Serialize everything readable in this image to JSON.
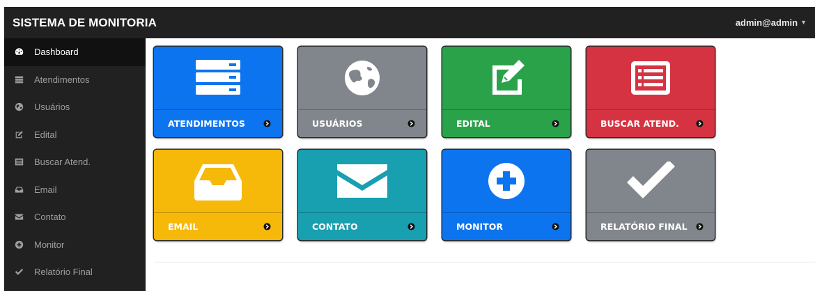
{
  "header": {
    "title": "SISTEMA DE MONITORIA",
    "user": "admin@admin"
  },
  "sidebar": {
    "items": [
      {
        "label": "Dashboard",
        "icon": "dashboard-icon",
        "active": true
      },
      {
        "label": "Atendimentos",
        "icon": "server-icon"
      },
      {
        "label": "Usuários",
        "icon": "globe-icon"
      },
      {
        "label": "Edital",
        "icon": "edit-icon"
      },
      {
        "label": "Buscar Atend.",
        "icon": "list-icon"
      },
      {
        "label": "Email",
        "icon": "inbox-icon"
      },
      {
        "label": "Contato",
        "icon": "envelope-icon"
      },
      {
        "label": "Monitor",
        "icon": "plus-circle-icon"
      },
      {
        "label": "Relatório Final",
        "icon": "check-icon"
      }
    ]
  },
  "tiles": [
    {
      "label": "ATENDIMENTOS",
      "icon": "server-icon",
      "color": "#0d74f0"
    },
    {
      "label": "USUÁRIOS",
      "icon": "globe-icon",
      "color": "#80868b"
    },
    {
      "label": "EDITAL",
      "icon": "edit-icon",
      "color": "#2aa24a"
    },
    {
      "label": "BUSCAR ATEND.",
      "icon": "list-icon",
      "color": "#d53342"
    },
    {
      "label": "EMAIL",
      "icon": "inbox-icon",
      "color": "#f6b809"
    },
    {
      "label": "CONTATO",
      "icon": "envelope-icon",
      "color": "#189fb0"
    },
    {
      "label": "MONITOR",
      "icon": "plus-circle-icon",
      "color": "#0d74f0"
    },
    {
      "label": "RELATÓRIO FINAL",
      "icon": "check-icon",
      "color": "#80868b"
    }
  ]
}
